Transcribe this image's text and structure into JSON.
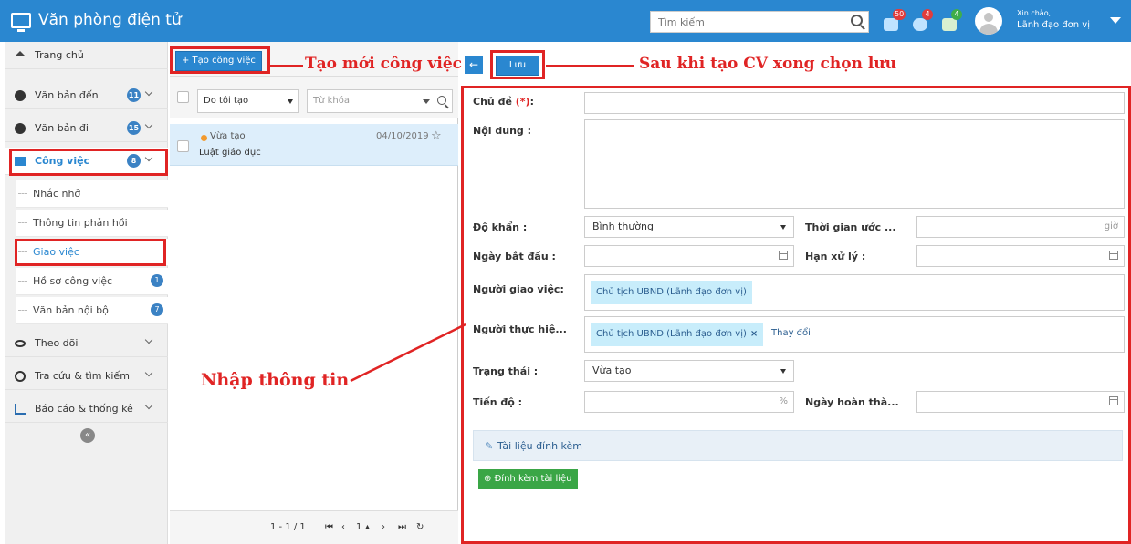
{
  "app": {
    "title": "Văn phòng điện tử"
  },
  "search": {
    "placeholder": "Tìm kiếm"
  },
  "notifications": {
    "calendar_count": "50",
    "chat_count": "4",
    "puzzle_count": "4"
  },
  "user": {
    "greeting": "Xin chào,",
    "name": "Lãnh đạo đơn vị"
  },
  "sidebar": {
    "items": [
      {
        "label": "Trang chủ",
        "icon": "home-icon"
      },
      {
        "label": "Văn bản đến",
        "count": "11",
        "icon": "arrow-right-circle-icon"
      },
      {
        "label": "Văn bản đi",
        "count": "15",
        "icon": "arrow-left-circle-icon"
      },
      {
        "label": "Công việc",
        "count": "8",
        "icon": "tasks-icon"
      },
      {
        "label": "Theo dõi",
        "icon": "eye-icon"
      },
      {
        "label": "Tra cứu & tìm kiếm",
        "icon": "search-icon"
      },
      {
        "label": "Báo cáo & thống kê",
        "icon": "bar-chart-icon"
      }
    ],
    "subitems": [
      {
        "label": "Nhắc nhở"
      },
      {
        "label": "Thông tin phản hồi"
      },
      {
        "label": "Giao việc"
      },
      {
        "label": "Hồ sơ công việc",
        "count": "1"
      },
      {
        "label": "Văn bản nội bộ",
        "count": "7"
      }
    ]
  },
  "list": {
    "create_label": "+ Tạo công việc",
    "filter_value": "Do tôi tạo",
    "keyword_placeholder": "Từ khóa",
    "row": {
      "status": "Vừa tạo",
      "date": "04/10/2019",
      "title": "Luật giáo dục"
    },
    "pager": {
      "range": "1 - 1 / 1",
      "page": "1"
    }
  },
  "form": {
    "save_label": "Lưu",
    "subject_label": "Chủ đề",
    "required_mark": "(*)",
    "content_label": "Nội dung :",
    "priority_label": "Độ khẩn :",
    "priority_value": "Bình thường",
    "est_time_label": "Thời gian ước ...",
    "hours_unit": "giờ",
    "start_label": "Ngày bắt đầu :",
    "deadline_label": "Hạn xử lý :",
    "assigner_label": "Người giao việc:",
    "assigner_value": "Chủ tịch UBND (Lãnh đạo đơn vị)",
    "executor_label": "Người thực hiệ...",
    "executor_value": "Chủ tịch UBND (Lãnh đạo đơn vị)",
    "change_label": "Thay đổi",
    "status_label": "Trạng thái :",
    "status_value": "Vừa tạo",
    "progress_label": "Tiến độ :",
    "percent_unit": "%",
    "complete_label": "Ngày hoàn thà...",
    "attach_header": "Tài liệu đính kèm",
    "attach_button": "Đính kèm tài liệu"
  },
  "annotations": {
    "create": "Tạo mới công việc",
    "save": "Sau khi tạo CV xong chọn lưu",
    "input": "Nhập thông tin"
  },
  "colors": {
    "primary": "#2a87d0",
    "annotation": "#e02424",
    "success": "#3aa646"
  }
}
